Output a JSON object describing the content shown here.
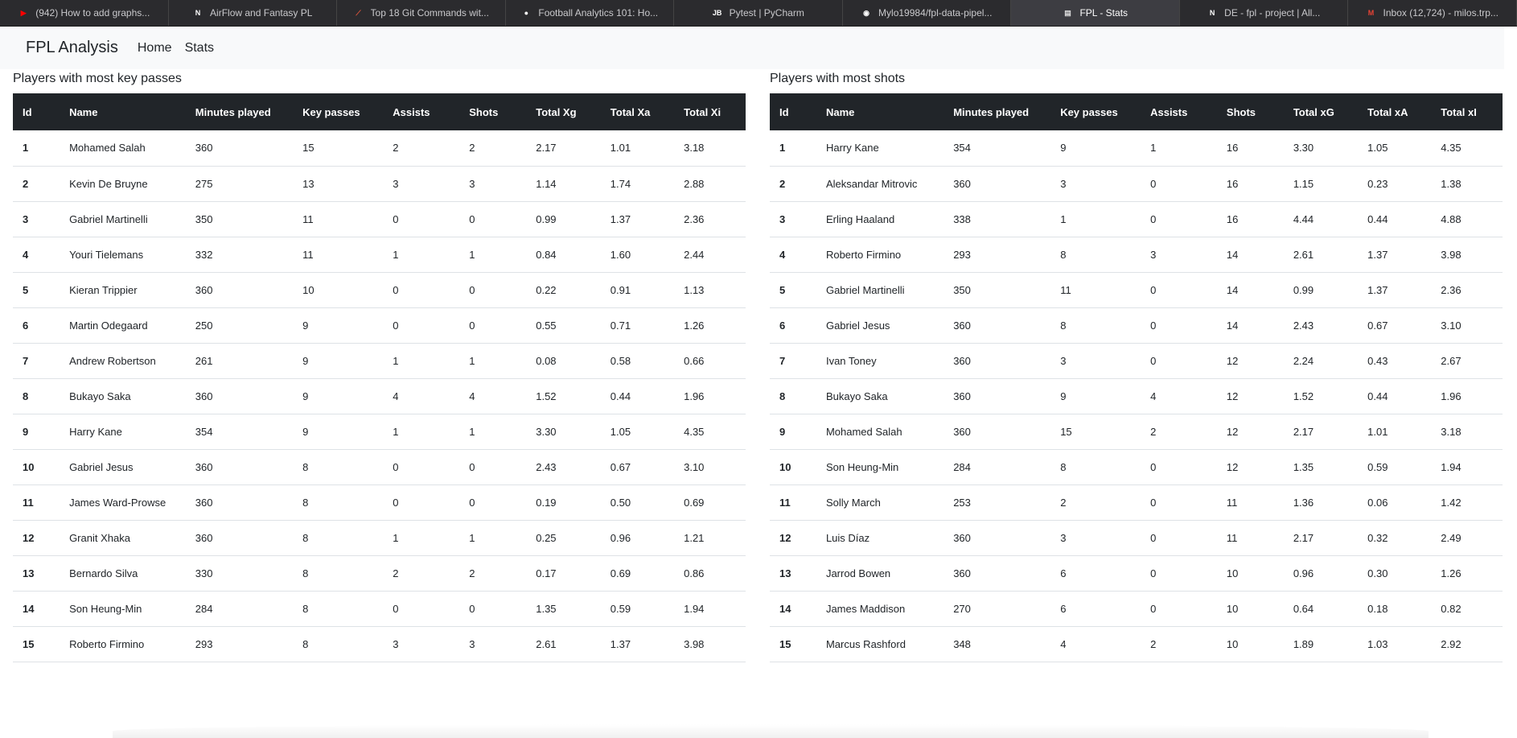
{
  "browser_tabs": [
    {
      "title": "(942) How to add graphs...",
      "icon": "youtube-icon",
      "color": "#ff0000",
      "glyph": "▶"
    },
    {
      "title": "AirFlow and Fantasy PL",
      "icon": "notion-icon",
      "color": "#ffffff",
      "glyph": "N"
    },
    {
      "title": "Top 18 Git Commands wit...",
      "icon": "article-icon",
      "color": "#e8573c",
      "glyph": "⟋"
    },
    {
      "title": "Football Analytics 101: Ho...",
      "icon": "medium-icon",
      "color": "#ffffff",
      "glyph": "●"
    },
    {
      "title": "Pytest | PyCharm",
      "icon": "jetbrains-icon",
      "color": "#ffffff",
      "glyph": "JB"
    },
    {
      "title": "Mylo19984/fpl-data-pipel...",
      "icon": "github-icon",
      "color": "#ffffff",
      "glyph": "◉"
    },
    {
      "title": "FPL - Stats",
      "icon": "page-icon",
      "color": "#dddddd",
      "glyph": "▤",
      "active": true
    },
    {
      "title": "DE - fpl - project | All...",
      "icon": "notion-icon",
      "color": "#ffffff",
      "glyph": "N"
    },
    {
      "title": "Inbox (12,724) - milos.trp...",
      "icon": "gmail-icon",
      "color": "#ea4335",
      "glyph": "M"
    }
  ],
  "navbar": {
    "brand": "FPL Analysis",
    "links": [
      "Home",
      "Stats"
    ]
  },
  "key_passes": {
    "title": "Players with most key passes",
    "headers": [
      "Id",
      "Name",
      "Minutes played",
      "Key passes",
      "Assists",
      "Shots",
      "Total Xg",
      "Total Xa",
      "Total Xi"
    ],
    "rows": [
      [
        "1",
        "Mohamed Salah",
        "360",
        "15",
        "2",
        "2",
        "2.17",
        "1.01",
        "3.18"
      ],
      [
        "2",
        "Kevin De Bruyne",
        "275",
        "13",
        "3",
        "3",
        "1.14",
        "1.74",
        "2.88"
      ],
      [
        "3",
        "Gabriel Martinelli",
        "350",
        "11",
        "0",
        "0",
        "0.99",
        "1.37",
        "2.36"
      ],
      [
        "4",
        "Youri Tielemans",
        "332",
        "11",
        "1",
        "1",
        "0.84",
        "1.60",
        "2.44"
      ],
      [
        "5",
        "Kieran Trippier",
        "360",
        "10",
        "0",
        "0",
        "0.22",
        "0.91",
        "1.13"
      ],
      [
        "6",
        "Martin Odegaard",
        "250",
        "9",
        "0",
        "0",
        "0.55",
        "0.71",
        "1.26"
      ],
      [
        "7",
        "Andrew Robertson",
        "261",
        "9",
        "1",
        "1",
        "0.08",
        "0.58",
        "0.66"
      ],
      [
        "8",
        "Bukayo Saka",
        "360",
        "9",
        "4",
        "4",
        "1.52",
        "0.44",
        "1.96"
      ],
      [
        "9",
        "Harry Kane",
        "354",
        "9",
        "1",
        "1",
        "3.30",
        "1.05",
        "4.35"
      ],
      [
        "10",
        "Gabriel Jesus",
        "360",
        "8",
        "0",
        "0",
        "2.43",
        "0.67",
        "3.10"
      ],
      [
        "11",
        "James Ward-Prowse",
        "360",
        "8",
        "0",
        "0",
        "0.19",
        "0.50",
        "0.69"
      ],
      [
        "12",
        "Granit Xhaka",
        "360",
        "8",
        "1",
        "1",
        "0.25",
        "0.96",
        "1.21"
      ],
      [
        "13",
        "Bernardo Silva",
        "330",
        "8",
        "2",
        "2",
        "0.17",
        "0.69",
        "0.86"
      ],
      [
        "14",
        "Son Heung-Min",
        "284",
        "8",
        "0",
        "0",
        "1.35",
        "0.59",
        "1.94"
      ],
      [
        "15",
        "Roberto Firmino",
        "293",
        "8",
        "3",
        "3",
        "2.61",
        "1.37",
        "3.98"
      ]
    ]
  },
  "shots": {
    "title": "Players with most shots",
    "headers": [
      "Id",
      "Name",
      "Minutes played",
      "Key passes",
      "Assists",
      "Shots",
      "Total xG",
      "Total xA",
      "Total xI"
    ],
    "rows": [
      [
        "1",
        "Harry Kane",
        "354",
        "9",
        "1",
        "16",
        "3.30",
        "1.05",
        "4.35"
      ],
      [
        "2",
        "Aleksandar Mitrovic",
        "360",
        "3",
        "0",
        "16",
        "1.15",
        "0.23",
        "1.38"
      ],
      [
        "3",
        "Erling Haaland",
        "338",
        "1",
        "0",
        "16",
        "4.44",
        "0.44",
        "4.88"
      ],
      [
        "4",
        "Roberto Firmino",
        "293",
        "8",
        "3",
        "14",
        "2.61",
        "1.37",
        "3.98"
      ],
      [
        "5",
        "Gabriel Martinelli",
        "350",
        "11",
        "0",
        "14",
        "0.99",
        "1.37",
        "2.36"
      ],
      [
        "6",
        "Gabriel Jesus",
        "360",
        "8",
        "0",
        "14",
        "2.43",
        "0.67",
        "3.10"
      ],
      [
        "7",
        "Ivan Toney",
        "360",
        "3",
        "0",
        "12",
        "2.24",
        "0.43",
        "2.67"
      ],
      [
        "8",
        "Bukayo Saka",
        "360",
        "9",
        "4",
        "12",
        "1.52",
        "0.44",
        "1.96"
      ],
      [
        "9",
        "Mohamed Salah",
        "360",
        "15",
        "2",
        "12",
        "2.17",
        "1.01",
        "3.18"
      ],
      [
        "10",
        "Son Heung-Min",
        "284",
        "8",
        "0",
        "12",
        "1.35",
        "0.59",
        "1.94"
      ],
      [
        "11",
        "Solly March",
        "253",
        "2",
        "0",
        "11",
        "1.36",
        "0.06",
        "1.42"
      ],
      [
        "12",
        "Luis Díaz",
        "360",
        "3",
        "0",
        "11",
        "2.17",
        "0.32",
        "2.49"
      ],
      [
        "13",
        "Jarrod Bowen",
        "360",
        "6",
        "0",
        "10",
        "0.96",
        "0.30",
        "1.26"
      ],
      [
        "14",
        "James Maddison",
        "270",
        "6",
        "0",
        "10",
        "0.64",
        "0.18",
        "0.82"
      ],
      [
        "15",
        "Marcus Rashford",
        "348",
        "4",
        "2",
        "10",
        "1.89",
        "1.03",
        "2.92"
      ]
    ]
  }
}
